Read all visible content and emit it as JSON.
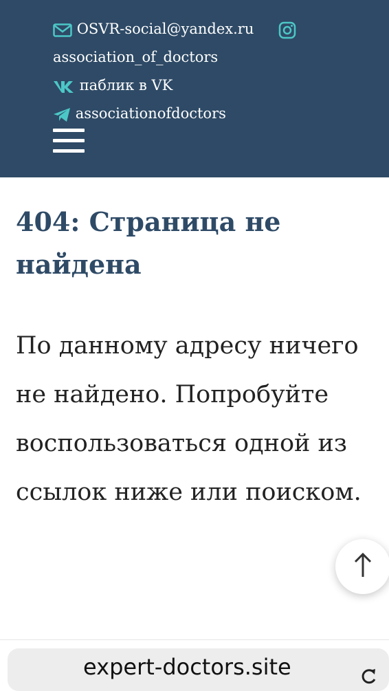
{
  "header": {
    "email": "OSVR-social@yandex.ru",
    "instagram": "association_of_doctors",
    "vk": "паблик в VK",
    "telegram": "associationofdoctors",
    "menu_icon": "hamburger-icon"
  },
  "main": {
    "title": "404: Страница не найдена",
    "message": "По данному адресу ничего не найдено. Попробуйте воспользоваться одной из ссылок ниже или поиском."
  },
  "scroll_top": {
    "icon": "arrow-up-icon"
  },
  "browser": {
    "url": "expert-doctors.site",
    "reload_icon": "reload-icon"
  },
  "colors": {
    "header_bg": "#2e4a66",
    "title": "#2e4a66",
    "text": "#222222"
  }
}
